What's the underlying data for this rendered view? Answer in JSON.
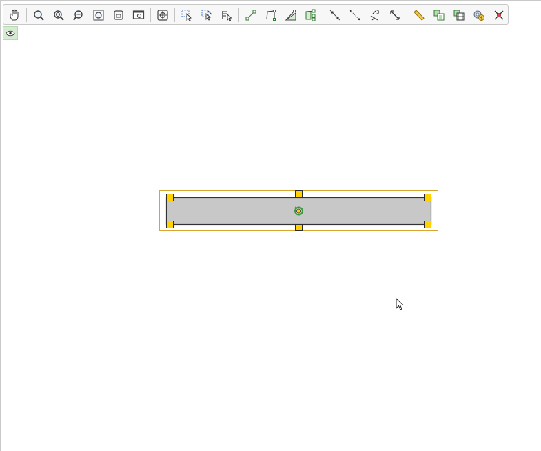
{
  "toolbar": {
    "tools": [
      {
        "name": "move-graphics-view-tool",
        "icon": "hand-icon"
      },
      {
        "name": "zoom-tool",
        "icon": "magnifier-icon"
      },
      {
        "name": "zoom-in-tool",
        "icon": "zoom-in-icon"
      },
      {
        "name": "zoom-out-tool",
        "icon": "zoom-out-icon"
      },
      {
        "name": "zoom-to-fit-tool",
        "icon": "zoom-fit-icon"
      },
      {
        "name": "zoom-window-tool",
        "icon": "zoom-window-icon"
      },
      {
        "name": "zoom-screen-tool",
        "icon": "zoom-screen-icon"
      },
      {
        "name": "center-view-tool",
        "icon": "crosshair-icon"
      },
      {
        "name": "select-tool",
        "icon": "select-arrow-icon"
      },
      {
        "name": "deselect-tool",
        "icon": "deselect-icon"
      },
      {
        "name": "select-text-tool",
        "icon": "text-select-icon"
      },
      {
        "name": "segment-tool",
        "icon": "segment-icon"
      },
      {
        "name": "polyline-tool",
        "icon": "polyline-icon"
      },
      {
        "name": "angle-tool",
        "icon": "angle-icon"
      },
      {
        "name": "vector-tool",
        "icon": "vector-icon"
      },
      {
        "name": "line-tool",
        "icon": "line-icon"
      },
      {
        "name": "ray-tool",
        "icon": "ray-icon"
      },
      {
        "name": "dilate-tool",
        "icon": "dilate-icon"
      },
      {
        "name": "translate-tool",
        "icon": "translate-icon"
      },
      {
        "name": "measure-tool",
        "icon": "ruler-icon"
      },
      {
        "name": "copy-style-tool",
        "icon": "copy-icon"
      },
      {
        "name": "animation-tool",
        "icon": "film-icon"
      },
      {
        "name": "settings-tool",
        "icon": "gear-icon"
      },
      {
        "name": "delete-tool",
        "icon": "delete-icon"
      }
    ]
  },
  "view_toggle": {
    "icon": "eye-icon",
    "active": true
  },
  "colors": {
    "handle_fill": "#ffd200",
    "handle_stroke": "#2b2b2b",
    "selection_outline": "#d8a630",
    "shape_fill": "#c8c8c8",
    "shape_stroke": "#333333",
    "rotate_handle": "#3c9a3c"
  }
}
